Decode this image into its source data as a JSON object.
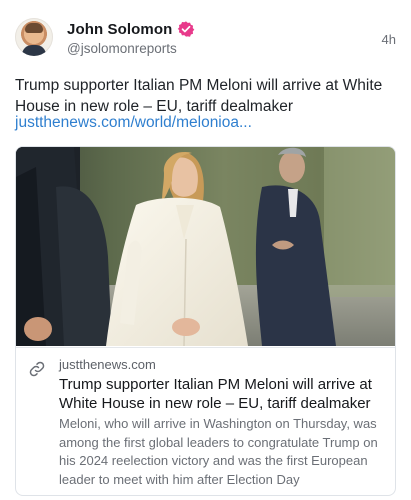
{
  "author": {
    "name": "John Solomon",
    "handle": "@jsolomonreports",
    "avatar_icon": "profile-photo",
    "verified_icon": "verified-badge-icon",
    "badge_color": "#e83a8b"
  },
  "timestamp": "4h",
  "post": {
    "text": "Trump supporter Italian PM Meloni will arrive at White House in new role – EU, tariff dealmaker",
    "link_text": "justthenews.com/world/melonioa..."
  },
  "card": {
    "image_icon": "article-photo",
    "link_icon": "link-icon",
    "domain": "justthenews.com",
    "title": "Trump supporter Italian PM Meloni will arrive at White House in new role – EU, tariff dealmaker",
    "description": "Meloni, who will arrive in Washington on Thursday, was among the first global leaders to congratulate Trump on his 2024 reelection victory and was the first European leader to meet with him after Election Day"
  },
  "colors": {
    "link": "#2f7fcf",
    "muted": "#6b6f76",
    "border": "#dfe3e8"
  }
}
